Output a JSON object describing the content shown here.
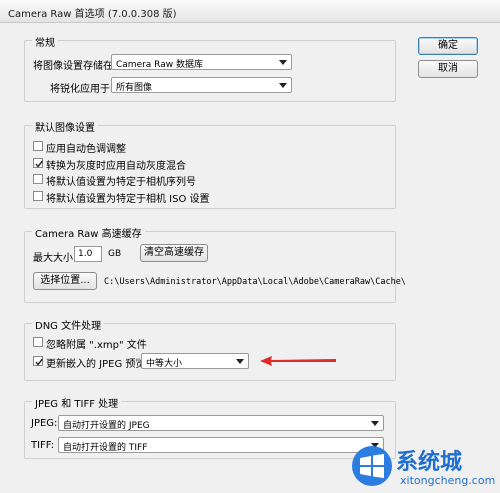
{
  "window": {
    "title": "Camera Raw 首选项  (7.0.0.308 版)"
  },
  "buttons": {
    "ok": "确定",
    "cancel": "取消"
  },
  "general": {
    "legend": "常规",
    "save_label": "将图像设置存储在:",
    "save_value": "Camera Raw 数据库",
    "sharpen_label": "将锐化应用于:",
    "sharpen_value": "所有图像"
  },
  "defaults": {
    "legend": "默认图像设置",
    "items": [
      {
        "label": "应用自动色调调整",
        "checked": false
      },
      {
        "label": "转换为灰度时应用自动灰度混合",
        "checked": true
      },
      {
        "label": "将默认值设置为特定于相机序列号",
        "checked": false
      },
      {
        "label": "将默认值设置为特定于相机 ISO 设置",
        "checked": false
      }
    ]
  },
  "cache": {
    "legend": "Camera Raw 高速缓存",
    "max_label": "最大大小:",
    "max_value": "1.0",
    "unit": "GB",
    "purge_button": "清空高速缓存",
    "select_button": "选择位置...",
    "path": "C:\\Users\\Administrator\\AppData\\Local\\Adobe\\CameraRaw\\Cache\\"
  },
  "dng": {
    "legend": "DNG 文件处理",
    "ignore_label": "忽略附属 \".xmp\" 文件",
    "ignore_checked": false,
    "update_label": "更新嵌入的 JPEG 预览:",
    "update_checked": true,
    "preview_value": "中等大小"
  },
  "jpeg_tiff": {
    "legend": "JPEG 和 TIFF 处理",
    "jpeg_label": "JPEG:",
    "jpeg_value": "自动打开设置的 JPEG",
    "tiff_label": "TIFF:",
    "tiff_value": "自动打开设置的 TIFF"
  },
  "watermark": {
    "big": "系统城",
    "small": "xitongcheng.com"
  },
  "colors": {
    "accent": "#1f6fd1",
    "arrow": "#e02a2a"
  }
}
